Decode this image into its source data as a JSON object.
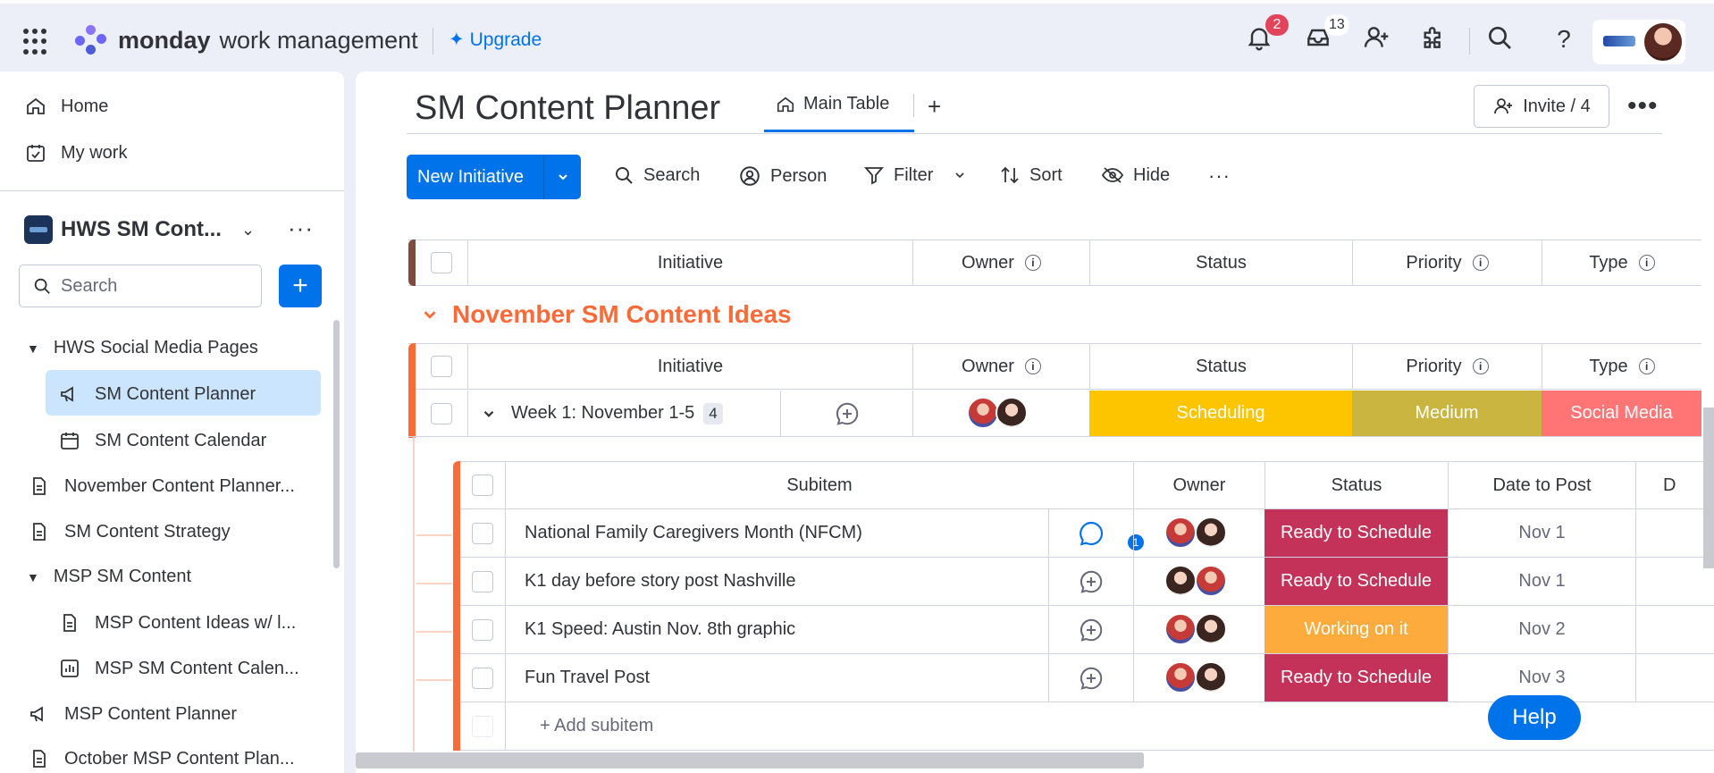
{
  "topbar": {
    "brand_bold": "monday",
    "brand_light": "work management",
    "upgrade": "Upgrade",
    "notifications_count": "2",
    "inbox_count": "13"
  },
  "sidebar": {
    "home": "Home",
    "my_work": "My work",
    "workspace_name": "HWS SM Cont...",
    "search_placeholder": "Search",
    "items": [
      {
        "label": "HWS Social Media Pages",
        "type": "folder"
      },
      {
        "label": "SM Content Planner",
        "type": "board-megaphone",
        "selected": true
      },
      {
        "label": "SM Content Calendar",
        "type": "calendar"
      },
      {
        "label": "November Content Planner...",
        "type": "doc"
      },
      {
        "label": "SM Content Strategy",
        "type": "doc"
      },
      {
        "label": "MSP SM Content",
        "type": "folder"
      },
      {
        "label": "MSP Content Ideas w/ l...",
        "type": "doc"
      },
      {
        "label": "MSP SM Content Calen...",
        "type": "chart"
      },
      {
        "label": "MSP Content Planner",
        "type": "board-megaphone"
      },
      {
        "label": "October MSP Content Plan...",
        "type": "doc"
      }
    ]
  },
  "board": {
    "title": "SM Content Planner",
    "tab": "Main Table",
    "invite": "Invite / 4"
  },
  "toolbar": {
    "new_item": "New Initiative",
    "search": "Search",
    "person": "Person",
    "filter": "Filter",
    "sort": "Sort",
    "hide": "Hide"
  },
  "columns": {
    "initiative": "Initiative",
    "owner": "Owner",
    "status": "Status",
    "priority": "Priority",
    "type": "Type"
  },
  "group": {
    "title": "November SM Content Ideas",
    "color": "#fb6a39"
  },
  "row": {
    "name": "Week 1: November 1-5",
    "subitem_count": "4",
    "status": "Scheduling",
    "status_color": "#fdc500",
    "priority": "Medium",
    "priority_color": "#c9b53f",
    "type": "Social Media",
    "type_color": "#ff7575"
  },
  "subitems": {
    "headers": {
      "subitem": "Subitem",
      "owner": "Owner",
      "status": "Status",
      "date": "Date to Post",
      "next": "D"
    },
    "rows": [
      {
        "name": "National Family Caregivers Month (NFCM)",
        "status": "Ready to Schedule",
        "color": "#c4325a",
        "date": "Nov 1",
        "updates": "1"
      },
      {
        "name": "K1 day before story post Nashville",
        "status": "Ready to Schedule",
        "color": "#c4325a",
        "date": "Nov 1"
      },
      {
        "name": "K1 Speed: Austin Nov. 8th graphic",
        "status": "Working on it",
        "color": "#fdab3d",
        "date": "Nov 2"
      },
      {
        "name": "Fun Travel Post",
        "status": "Ready to Schedule",
        "color": "#c4325a",
        "date": "Nov 3"
      }
    ],
    "add": "+ Add subitem"
  },
  "help": "Help"
}
